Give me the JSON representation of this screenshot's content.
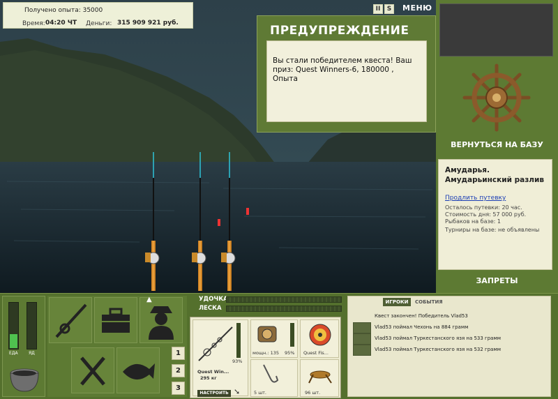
{
  "top_info": {
    "exp_text": "Получено опыта: 35000",
    "time_label": "Время:",
    "time_value": "04:20 ЧТ",
    "money_label": "Деньги:",
    "money_value": "315 909 921 руб."
  },
  "top_controls": {
    "pause_label": "II",
    "sound_label": "S",
    "menu_label": "МЕНЮ"
  },
  "warning": {
    "title": "ПРЕДУПРЕЖДЕНИЕ",
    "message": "Вы стали победителем квеста! Ваш приз: Quest Winners-6, 180000 , Опыта"
  },
  "right_panel": {
    "return_label": "ВЕРНУТЬСЯ НА БАЗУ",
    "location_name": "Амударья. Амударьинский разлив",
    "extend_link": "Продлить путевку",
    "info_lines": [
      "Осталось путевки: 20 час.",
      "Стоимость дня: 57 000 руб.",
      "Рыбаков на базе: 1",
      "Турниры на базе: не объявлены"
    ],
    "bans_label": "ЗАПРЕТЫ"
  },
  "stats": {
    "food_label": "ЕДА",
    "poison_label": "ЯД",
    "food_level": 0.3,
    "poison_level": 0.0
  },
  "rod_bars": {
    "rod_label": "УДОЧКА",
    "line_label": "ЛЕСКА"
  },
  "tackle": {
    "rod_percent": "93%",
    "rod_name": "Quest Win...",
    "rod_weight": "295 кг",
    "setup_label": "НАСТРОИТЬ",
    "reel_power": "мощн.: 135",
    "reel_percent": "95%",
    "line_name": "Quest Fis...",
    "hooks_count": "5 шт.",
    "bait_count": "96 шт."
  },
  "side_numbers": [
    "1",
    "2",
    "3"
  ],
  "events": {
    "tab_players": "ИГРОКИ",
    "tab_events": "СОБЫТИЯ",
    "items": [
      "Квест закончен! Победитель Vlad53",
      "Vlad53 поймал Чехонь на 884 грамм",
      "Vlad53 поймал Туркестанского язя на 533 грамм",
      "Vlad53 поймал Туркестанского язя на 532 грамм"
    ]
  },
  "colors": {
    "panel_green": "#5d7a33",
    "bar_green": "#4fc24f",
    "link_blue": "#1a3db5"
  }
}
